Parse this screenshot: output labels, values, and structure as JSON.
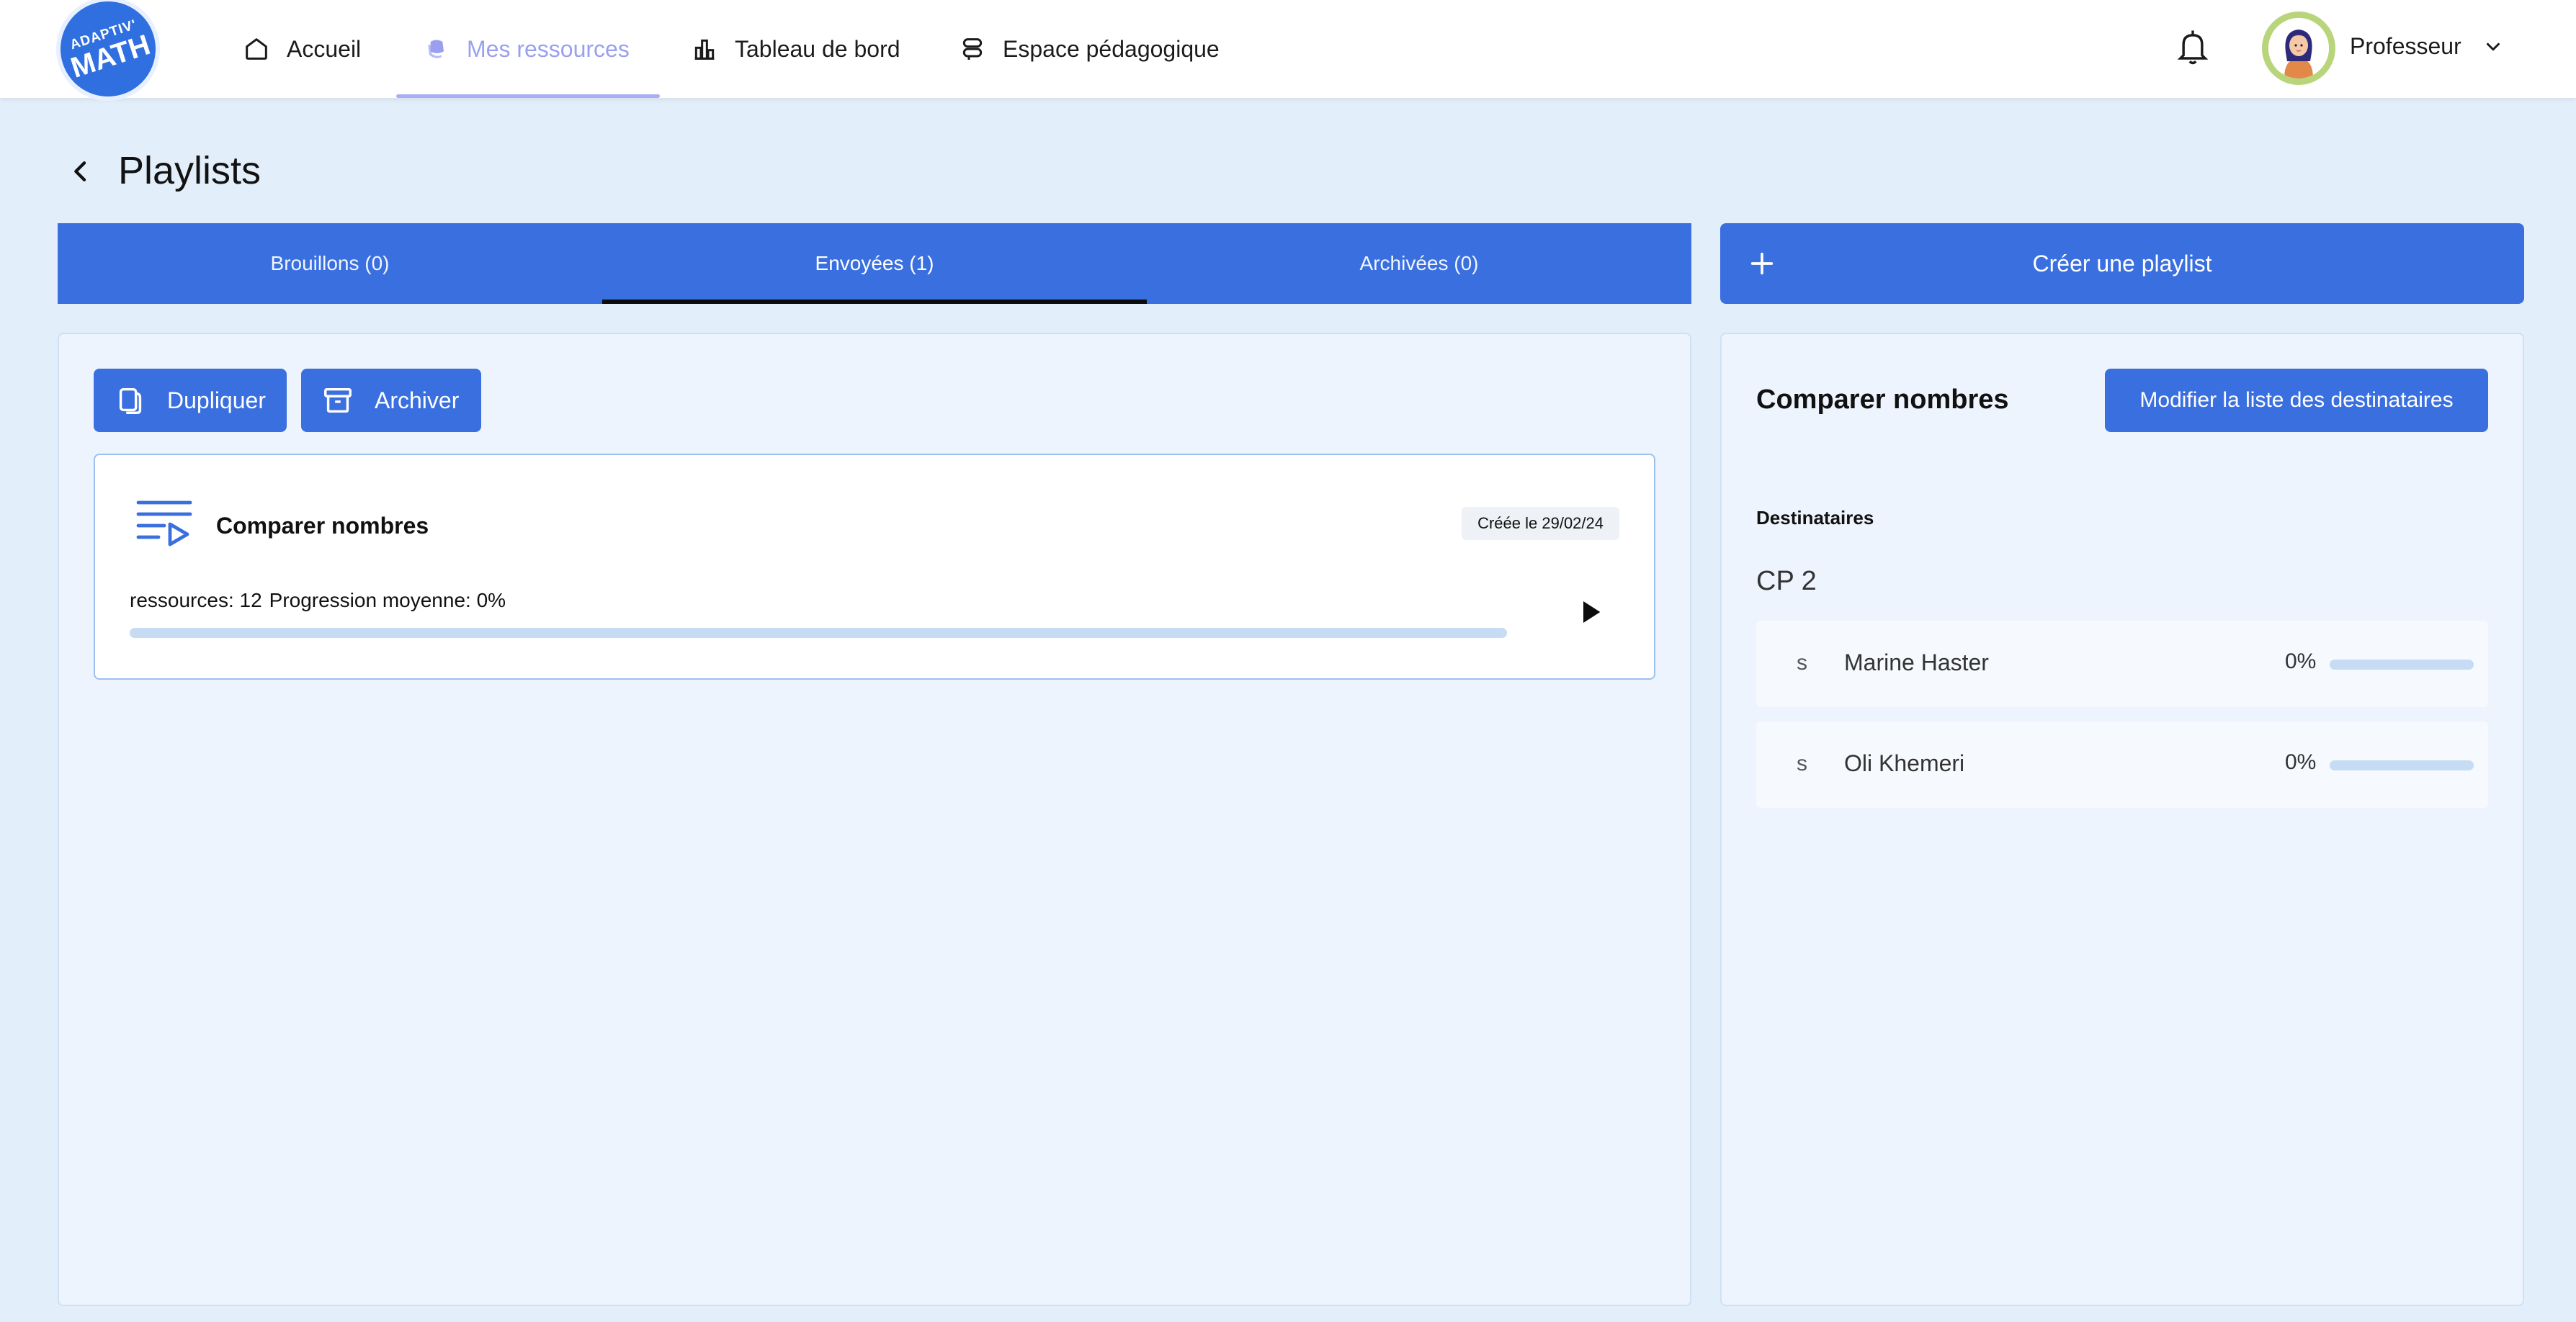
{
  "brand": {
    "logo_line1": "ADAPTIV'",
    "logo_line2": "MATH",
    "primary_color": "#3a6fe0",
    "active_nav_color": "#9aa0ef"
  },
  "nav": {
    "items": [
      {
        "label": "Accueil",
        "icon": "home-icon",
        "active": false
      },
      {
        "label": "Mes ressources",
        "icon": "resources-icon",
        "active": true
      },
      {
        "label": "Tableau de bord",
        "icon": "dashboard-icon",
        "active": false
      },
      {
        "label": "Espace pédagogique",
        "icon": "pedagogy-icon",
        "active": false
      }
    ]
  },
  "header": {
    "notifications_icon": "bell-icon",
    "profile_name": "Professeur"
  },
  "page": {
    "title": "Playlists"
  },
  "tabs": [
    {
      "label": "Brouillons (0)",
      "active": false
    },
    {
      "label": "Envoyées (1)",
      "active": true
    },
    {
      "label": "Archivées (0)",
      "active": false
    }
  ],
  "create_button": {
    "label": "Créer une playlist"
  },
  "actions": {
    "duplicate_label": "Dupliquer",
    "archive_label": "Archiver"
  },
  "playlist_card": {
    "title": "Comparer nombres",
    "created": "Créée le 29/02/24",
    "resources_text": "ressources: 12",
    "progress_text": "Progression moyenne: 0%",
    "progress": 0
  },
  "details": {
    "title": "Comparer nombres",
    "modify_button": "Modifier la liste des destinataires",
    "recipients_label": "Destinataires",
    "class_name": "CP 2",
    "students": [
      {
        "initial": "s",
        "name": "Marine Haster",
        "percent": "0%",
        "progress": 0
      },
      {
        "initial": "s",
        "name": "Oli Khemeri",
        "percent": "0%",
        "progress": 0
      }
    ]
  }
}
